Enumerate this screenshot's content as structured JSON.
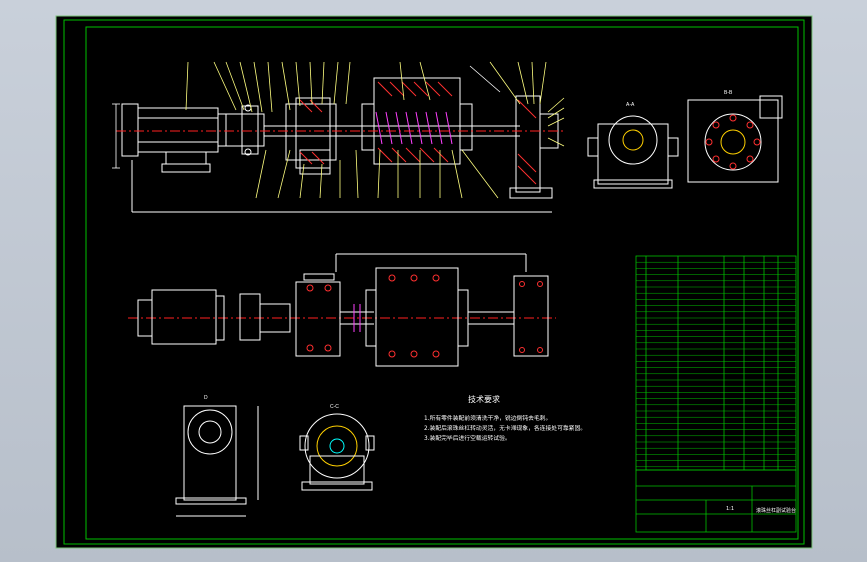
{
  "colors": {
    "background": "#000000",
    "frame": "#00c000",
    "lines": "#ffffff",
    "hatch": "#ff3030",
    "center": "#ff2020",
    "dimension": "#ffff00",
    "parts_yellow": "#ffd000",
    "balloon": "#ffff80",
    "cyan": "#00ffff",
    "magenta": "#ff40ff"
  },
  "views": {
    "section_a_label": "A-A",
    "section_b_label": "B-B",
    "section_c_label": "C-C",
    "view_d_label": "D"
  },
  "notes": {
    "title": "技术要求",
    "lines": [
      "1.所有零件装配前须清洗干净，锐边倒钝去毛刺。",
      "2.装配后滚珠丝杠转动灵活，无卡滞现象，各连接处可靠紧固。",
      "3.装配完毕后进行空载运转试验。"
    ]
  },
  "title_block": {
    "drawing_name": "滚珠丝杠副试验台",
    "scale": "1:1"
  }
}
